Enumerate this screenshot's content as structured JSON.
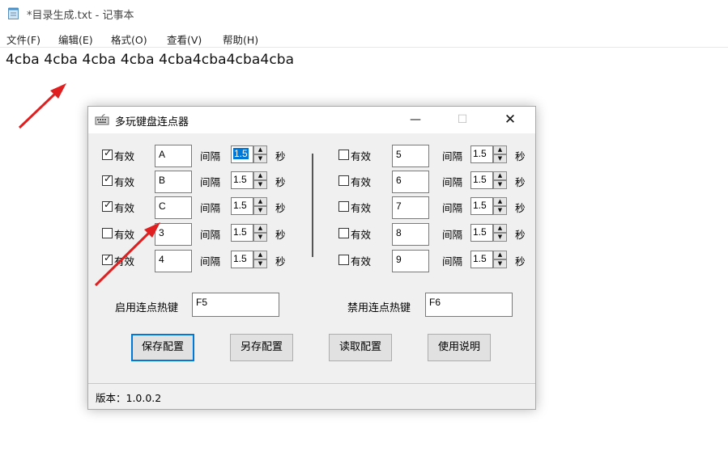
{
  "notepad": {
    "title": "*目录生成.txt - 记事本",
    "menu": [
      "文件(F)",
      "编辑(E)",
      "格式(O)",
      "查看(V)",
      "帮助(H)"
    ],
    "content": "4cba 4cba 4cba 4cba 4cba4cba4cba4cba"
  },
  "dialog": {
    "title": "多玩键盘连点器",
    "min_symbol": "—",
    "max_symbol": "☐",
    "close_symbol": "✕",
    "effective_label": "有效",
    "interval_label": "间隔",
    "seconds_label": "秒",
    "left_rows": [
      {
        "checked": true,
        "key": "A",
        "interval": "1.5"
      },
      {
        "checked": true,
        "key": "B",
        "interval": "1.5"
      },
      {
        "checked": true,
        "key": "C",
        "interval": "1.5"
      },
      {
        "checked": false,
        "key": "3",
        "interval": "1.5"
      },
      {
        "checked": true,
        "key": "4",
        "interval": "1.5"
      }
    ],
    "right_rows": [
      {
        "checked": false,
        "key": "5",
        "interval": "1.5"
      },
      {
        "checked": false,
        "key": "6",
        "interval": "1.5"
      },
      {
        "checked": false,
        "key": "7",
        "interval": "1.5"
      },
      {
        "checked": false,
        "key": "8",
        "interval": "1.5"
      },
      {
        "checked": false,
        "key": "9",
        "interval": "1.5"
      }
    ],
    "enable_hotkey_label": "启用连点热键",
    "enable_hotkey_value": "F5",
    "disable_hotkey_label": "禁用连点热键",
    "disable_hotkey_value": "F6",
    "buttons": [
      "保存配置",
      "另存配置",
      "读取配置",
      "使用说明"
    ],
    "status": "版本：1.0.0.2"
  },
  "colors": {
    "accent": "#0078d7",
    "arrow": "#e02020",
    "dialog_bg": "#f0f0f0"
  }
}
